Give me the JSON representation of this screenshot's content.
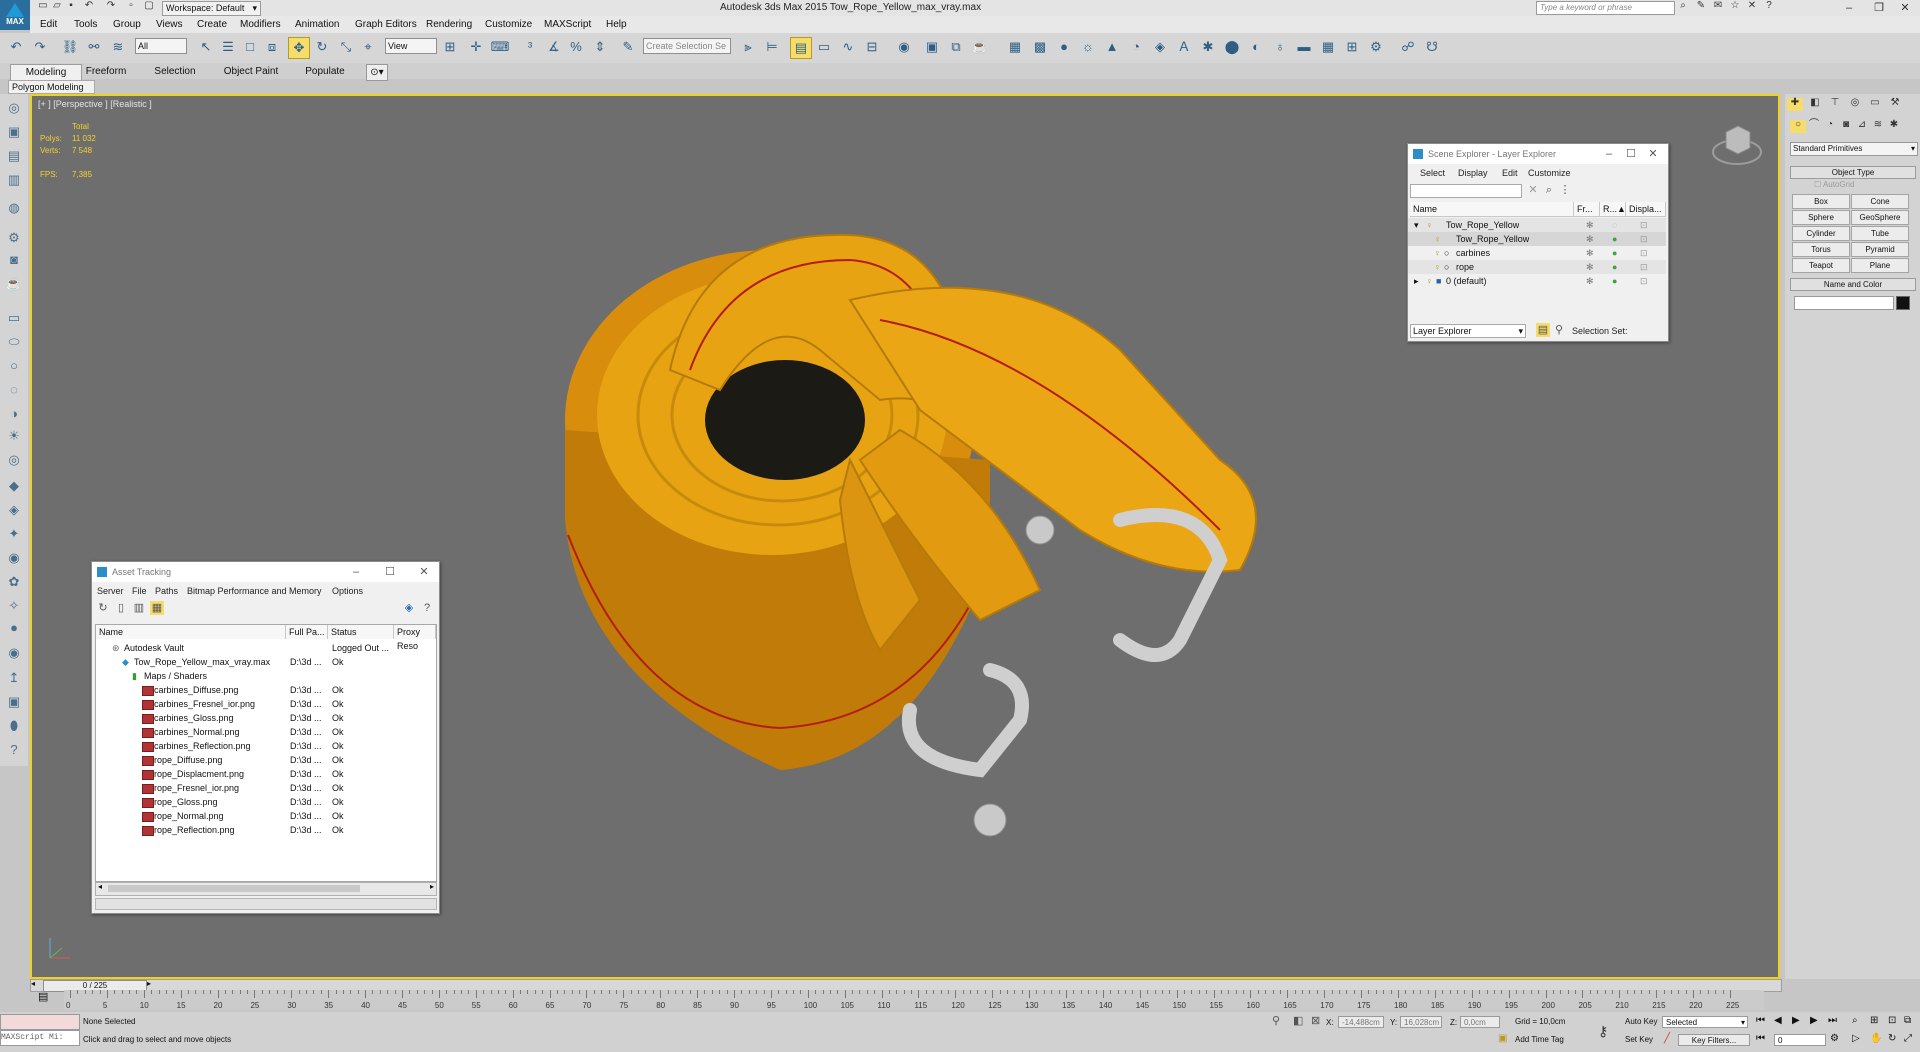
{
  "app": {
    "title": "Autodesk 3ds Max  2015    Tow_Rope_Yellow_max_vray.max",
    "logo_label": "MAX",
    "workspace": "Workspace: Default",
    "search_placeholder": "Type a keyword or phrase"
  },
  "menubar": [
    "Edit",
    "Tools",
    "Group",
    "Views",
    "Create",
    "Modifiers",
    "Animation",
    "Graph Editors",
    "Rendering",
    "Customize",
    "MAXScript",
    "Help"
  ],
  "toolbar": {
    "selection_filter": "All",
    "ref_coord": "View",
    "named_selection_placeholder": "Create Selection Se"
  },
  "ribbon": {
    "tabs": [
      "Modeling",
      "Freeform",
      "Selection",
      "Object Paint",
      "Populate"
    ],
    "active_panel": "Polygon Modeling"
  },
  "viewport": {
    "label": "[+ ] [Perspective ] [Realistic ]",
    "stats": {
      "total_label": "Total",
      "polys_label": "Polys:",
      "polys_value": "11 032",
      "verts_label": "Verts:",
      "verts_value": "7 548",
      "fps_label": "FPS:",
      "fps_value": "7,385"
    }
  },
  "scene_explorer": {
    "title": "Scene Explorer - Layer Explorer",
    "menus": [
      "Select",
      "Display",
      "Edit",
      "Customize"
    ],
    "columns": [
      "Name",
      "Fr...",
      "R...▲",
      "Displa..."
    ],
    "rows": [
      {
        "name": "Tow_Rope_Yellow"
      },
      {
        "name": "Tow_Rope_Yellow"
      },
      {
        "name": "carbines"
      },
      {
        "name": "rope"
      },
      {
        "name": "0 (default)"
      }
    ],
    "footer_dropdown": "Layer Explorer",
    "selection_set_label": "Selection Set:"
  },
  "asset_tracking": {
    "title": "Asset Tracking",
    "menus": [
      "Server",
      "File",
      "Paths",
      "Bitmap Performance and Memory",
      "Options"
    ],
    "columns": [
      "Name",
      "Full Pa...",
      "Status",
      "Proxy Reso"
    ],
    "rows": [
      {
        "name": "Autodesk Vault",
        "path": "",
        "status": "Logged Out ..."
      },
      {
        "name": "Tow_Rope_Yellow_max_vray.max",
        "path": "D:\\3d ...",
        "status": "Ok"
      },
      {
        "name": "Maps / Shaders",
        "path": "",
        "status": ""
      },
      {
        "name": "carbines_Diffuse.png",
        "path": "D:\\3d ...",
        "status": "Ok"
      },
      {
        "name": "carbines_Fresnel_ior.png",
        "path": "D:\\3d ...",
        "status": "Ok"
      },
      {
        "name": "carbines_Gloss.png",
        "path": "D:\\3d ...",
        "status": "Ok"
      },
      {
        "name": "carbines_Normal.png",
        "path": "D:\\3d ...",
        "status": "Ok"
      },
      {
        "name": "carbines_Reflection.png",
        "path": "D:\\3d ...",
        "status": "Ok"
      },
      {
        "name": "rope_Diffuse.png",
        "path": "D:\\3d ...",
        "status": "Ok"
      },
      {
        "name": "rope_Displacment.png",
        "path": "D:\\3d ...",
        "status": "Ok"
      },
      {
        "name": "rope_Fresnel_ior.png",
        "path": "D:\\3d ...",
        "status": "Ok"
      },
      {
        "name": "rope_Gloss.png",
        "path": "D:\\3d ...",
        "status": "Ok"
      },
      {
        "name": "rope_Normal.png",
        "path": "D:\\3d ...",
        "status": "Ok"
      },
      {
        "name": "rope_Reflection.png",
        "path": "D:\\3d ...",
        "status": "Ok"
      }
    ]
  },
  "command_panel": {
    "category": "Standard Primitives",
    "object_type_header": "Object Type",
    "autogrid_label": "AutoGrid",
    "buttons": [
      "Box",
      "Cone",
      "Sphere",
      "GeoSphere",
      "Cylinder",
      "Tube",
      "Torus",
      "Pyramid",
      "Teapot",
      "Plane"
    ],
    "name_color_header": "Name and Color"
  },
  "timeline": {
    "frame_display": "0 / 225",
    "ticks": [
      "0",
      "5",
      "10",
      "15",
      "20",
      "25",
      "30",
      "35",
      "40",
      "45",
      "50",
      "55",
      "60",
      "65",
      "70",
      "75",
      "80",
      "85",
      "90",
      "95",
      "100",
      "105",
      "110",
      "115",
      "120",
      "125",
      "130",
      "135",
      "140",
      "145",
      "150",
      "155",
      "160",
      "165",
      "170",
      "175",
      "180",
      "185",
      "190",
      "195",
      "200",
      "205",
      "210",
      "215",
      "220",
      "225"
    ]
  },
  "status": {
    "maxscript_label": "MAXScript Mi:",
    "selection": "None Selected",
    "prompt": "Click and drag to select and move objects",
    "x_label": "X:",
    "x_value": "-14,488cm",
    "y_label": "Y:",
    "y_value": "16,028cm",
    "z_label": "Z:",
    "z_value": "0,0cm",
    "grid": "Grid = 10,0cm",
    "add_time_tag": "Add Time Tag",
    "auto_key": "Auto Key",
    "set_key": "Set Key",
    "key_mode": "Selected",
    "key_filters": "Key Filters...",
    "current_frame": "0"
  },
  "colors": {
    "viewport_bg": "#6e6e6e",
    "active_border": "#f0d021",
    "rope_yellow": "#e8a312",
    "stripe_red": "#b41d14",
    "shackle_gray": "#cfcfcf"
  }
}
